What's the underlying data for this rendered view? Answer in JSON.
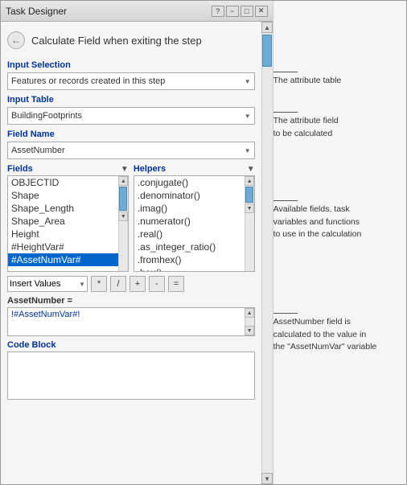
{
  "window": {
    "title": "Task Designer",
    "controls": [
      "?",
      "−",
      "□",
      "✕"
    ]
  },
  "header": {
    "step_title": "Calculate Field when exiting the step"
  },
  "input_selection": {
    "label": "Input Selection",
    "value": "Features or records created in this step",
    "placeholder": "Features or records created in this step"
  },
  "input_table": {
    "label": "Input Table",
    "value": "BuildingFootprints"
  },
  "field_name": {
    "label": "Field Name",
    "value": "AssetNumber"
  },
  "fields": {
    "label": "Fields",
    "items": [
      "OBJECTID",
      "Shape",
      "Shape_Length",
      "Shape_Area",
      "Height",
      "#HeightVar#",
      "#AssetNumVar#"
    ],
    "selected": "#AssetNumVar#"
  },
  "helpers": {
    "label": "Helpers",
    "items": [
      ".conjugate()",
      ".denominator()",
      ".imag()",
      ".numerator()",
      ".real()",
      ".as_integer_ratio()",
      ".fromhex()",
      ".hex()"
    ]
  },
  "operators": {
    "insert_label": "Insert Values",
    "buttons": [
      "*",
      "/",
      "+",
      "-",
      "="
    ]
  },
  "expression": {
    "label": "AssetNumber =",
    "value": "!#AssetNumVar#!"
  },
  "code_block": {
    "label": "Code Block"
  },
  "annotations": {
    "attr_table": "The attribute table",
    "attr_field": "The attribute field\nto be calculated",
    "avail_fields": "Available fields, task\nvariables and functions\nto use in the calculation",
    "calc_note": "AssetNumber field is\ncalculated to the value in\nthe \"AssetNumVar\" variable"
  }
}
